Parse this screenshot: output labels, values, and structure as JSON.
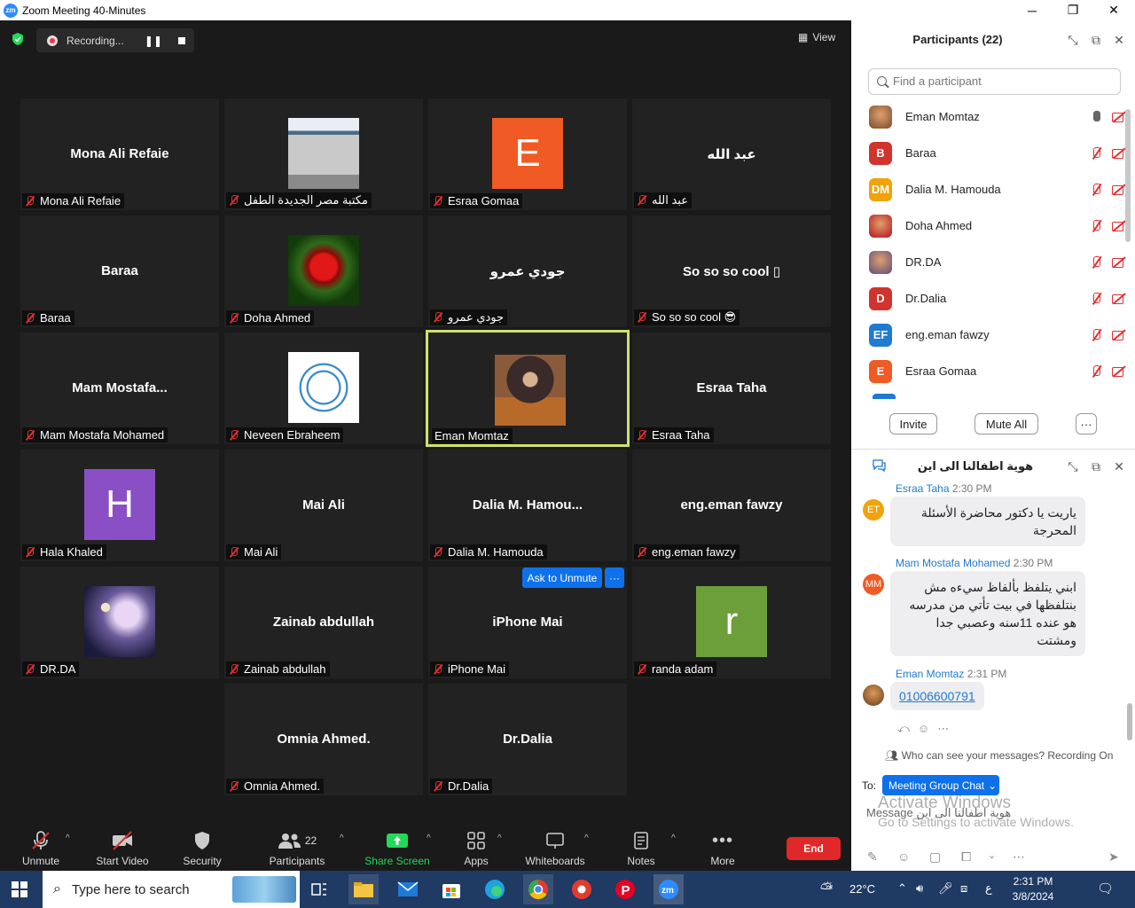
{
  "window": {
    "title": "Zoom Meeting 40-Minutes"
  },
  "recording": {
    "label": "Recording..."
  },
  "view": {
    "label": "View"
  },
  "tiles": [
    {
      "center": "Mona Ali Refaie",
      "name": "Mona Ali Refaie"
    },
    {
      "center": "",
      "name": "مكتبة مصر الجديدة الطفل"
    },
    {
      "center": "",
      "name": "Esraa Gomaa",
      "letter": "E",
      "color": "#f05a24"
    },
    {
      "center": "عبد الله",
      "name": "عبد الله"
    },
    {
      "center": "Baraa",
      "name": "Baraa"
    },
    {
      "center": "",
      "name": "Doha Ahmed"
    },
    {
      "center": "جودي عمرو",
      "name": "جودي عمرو"
    },
    {
      "center": "So so so cool ▯",
      "name": "So so so cool 😎"
    },
    {
      "center": "Mam  Mostafa...",
      "name": "Mam Mostafa Mohamed"
    },
    {
      "center": "",
      "name": "Neveen Ebraheem"
    },
    {
      "center": "",
      "name": "Eman Momtaz"
    },
    {
      "center": "Esraa Taha",
      "name": "Esraa Taha"
    },
    {
      "center": "",
      "name": "Hala Khaled",
      "letter": "H",
      "color": "#8a4fc4"
    },
    {
      "center": "Mai Ali",
      "name": "Mai Ali"
    },
    {
      "center": "Dalia  M.  Hamou...",
      "name": "Dalia M. Hamouda"
    },
    {
      "center": "eng.eman fawzy",
      "name": "eng.eman fawzy"
    },
    {
      "center": "",
      "name": "DR.DA"
    },
    {
      "center": "Zainab abdullah",
      "name": "Zainab abdullah"
    },
    {
      "center": "iPhone  Mai",
      "name": "iPhone Mai"
    },
    {
      "center": "",
      "name": "randa adam",
      "letter": "r",
      "color": "#6c9f3a"
    },
    {
      "center": "Omnia Ahmed.",
      "name": "Omnia Ahmed."
    },
    {
      "center": "Dr.Dalia",
      "name": "Dr.Dalia"
    }
  ],
  "ask_to_unmute": {
    "label": "Ask to Unmute",
    "more": "···"
  },
  "toolbar": {
    "unmute": "Unmute",
    "start_video": "Start Video",
    "security": "Security",
    "participants": "Participants",
    "participants_count": "22",
    "share_screen": "Share Screen",
    "apps": "Apps",
    "whiteboards": "Whiteboards",
    "notes": "Notes",
    "more": "More",
    "end": "End"
  },
  "participants_panel": {
    "title": "Participants (22)",
    "search_placeholder": "Find a participant",
    "list": [
      {
        "name": "Eman Momtaz",
        "initials": "",
        "color": "#7a4a2a",
        "mic_on": true
      },
      {
        "name": "Baraa",
        "initials": "B",
        "color": "#d0342c"
      },
      {
        "name": "Dalia M. Hamouda",
        "initials": "DM",
        "color": "#f0a30a"
      },
      {
        "name": "Doha Ahmed",
        "initials": "",
        "color": "#b5121b"
      },
      {
        "name": "DR.DA",
        "initials": "",
        "color": "#5a4c7a"
      },
      {
        "name": "Dr.Dalia",
        "initials": "D",
        "color": "#d0342c"
      },
      {
        "name": "eng.eman fawzy",
        "initials": "EF",
        "color": "#1f7ad1"
      },
      {
        "name": "Esraa Gomaa",
        "initials": "E",
        "color": "#f05a24"
      }
    ],
    "invite": "Invite",
    "mute_all": "Mute All",
    "more": "···"
  },
  "chat": {
    "title": "هوية اطفالنا الى اين",
    "messages": [
      {
        "sender": "Esraa Taha",
        "time": "2:30 PM",
        "avatar": "ET",
        "color": "#f0a30a",
        "text": "ياريت يا دكتور محاضرة الأسئلة المحرجة"
      },
      {
        "sender": "Mam Mostafa Mohamed",
        "time": "2:30 PM",
        "avatar": "MM",
        "color": "#f05a24",
        "text": "ابني يتلفظ بألفاظ سيءه مش بنتلفظها في بيت تأتي من مدرسه  هو عنده 11سنه وعصبي جدا ومشتت"
      },
      {
        "sender": "Eman Momtaz",
        "time": "2:31 PM",
        "avatar": "",
        "color": "#7a4a2a",
        "text": "01006600791"
      }
    ],
    "who_can_see": "Who can see your messages? Recording On",
    "to_label": "To:",
    "to_value": "Meeting Group Chat",
    "input_placeholder": "Message هوية اطفالنا الى اين",
    "watermark_title": "Activate Windows",
    "watermark_sub": "Go to Settings to activate Windows."
  },
  "taskbar": {
    "search": "Type here to search",
    "temp": "22°C",
    "lang": "ع",
    "time": "2:31 PM",
    "date": "3/8/2024"
  },
  "colors": {
    "accent": "#0e71eb",
    "muted": "#e02f2f",
    "active_border": "#cfe26a",
    "end": "#e02828",
    "share": "#23d959"
  }
}
